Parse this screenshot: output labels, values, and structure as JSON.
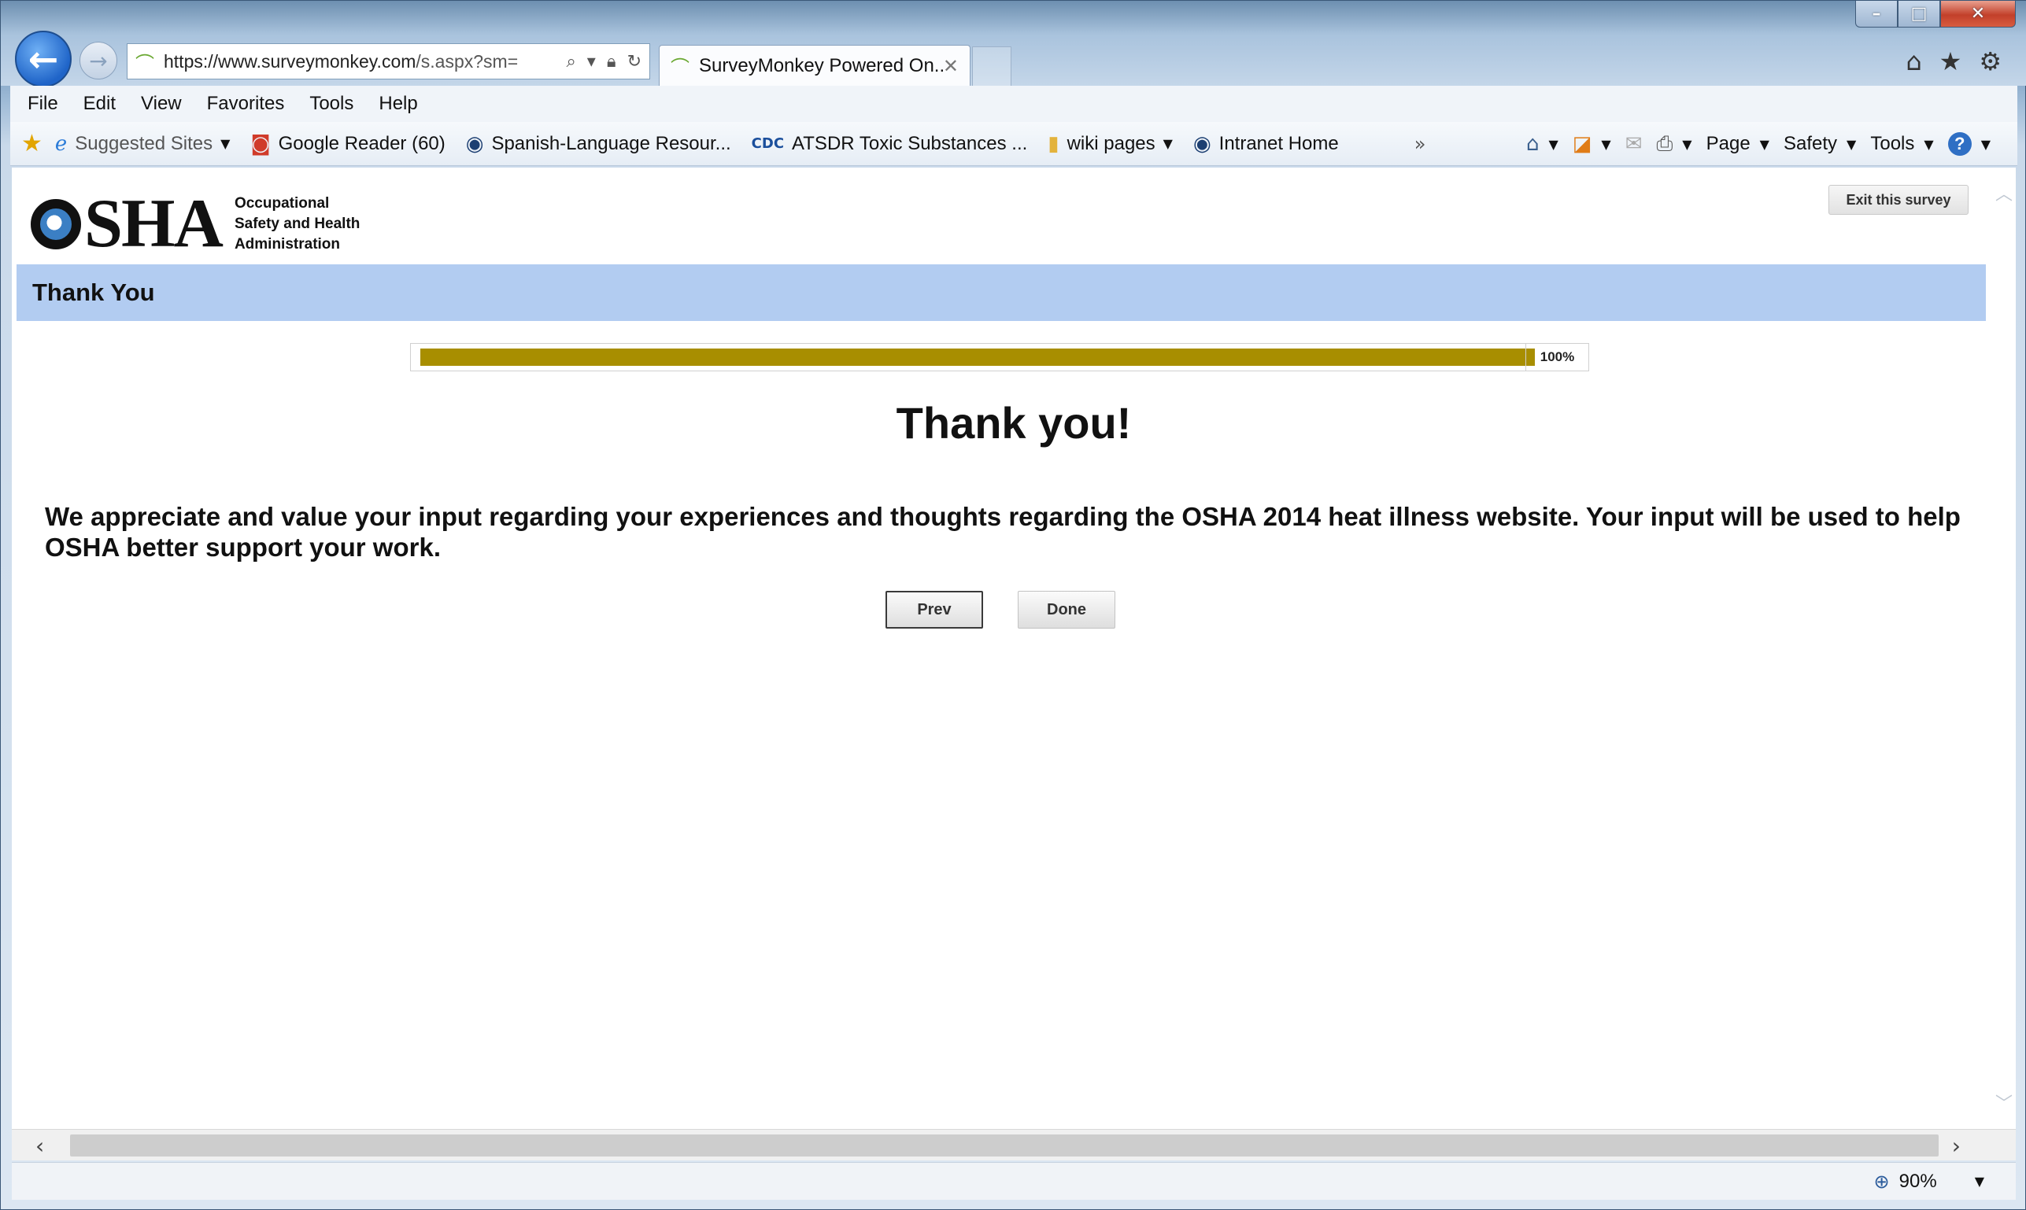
{
  "browser": {
    "address_url_main": "https://www.surveymonkey.com",
    "address_url_rest": "/s.aspx?sm=",
    "tab_title": "SurveyMonkey Powered On...",
    "menu": [
      "File",
      "Edit",
      "View",
      "Favorites",
      "Tools",
      "Help"
    ],
    "favorites": [
      {
        "label": "Suggested Sites",
        "icon": "ie-icon",
        "dropdown": true
      },
      {
        "label": "Google Reader (60)",
        "icon": "google-reader-icon",
        "dropdown": false
      },
      {
        "label": "Spanish-Language Resour...",
        "icon": "osha-icon",
        "dropdown": false
      },
      {
        "label": "ATSDR Toxic Substances ...",
        "icon": "cdc-icon",
        "dropdown": false
      },
      {
        "label": "wiki pages",
        "icon": "folder-icon",
        "dropdown": true
      },
      {
        "label": "Intranet Home",
        "icon": "osha-icon",
        "dropdown": false
      }
    ],
    "command_bar": {
      "page": "Page",
      "safety": "Safety",
      "tools": "Tools"
    },
    "zoom": "90%"
  },
  "page": {
    "agency_line1": "Occupational",
    "agency_line2": "Safety and Health",
    "agency_line3": "Administration",
    "logo_text": "SHA",
    "exit_label": "Exit this survey",
    "header_title": "Thank You",
    "progress_percent": 100,
    "progress_label": "100%",
    "thanks_title": "Thank you!",
    "message": "We appreciate and value your input regarding your experiences and thoughts regarding the OSHA 2014 heat illness website. Your input will be used to help OSHA better support your work.",
    "prev_label": "Prev",
    "done_label": "Done"
  },
  "colors": {
    "header_band": "#b2ccf1",
    "progress_fill": "#a88e00"
  }
}
